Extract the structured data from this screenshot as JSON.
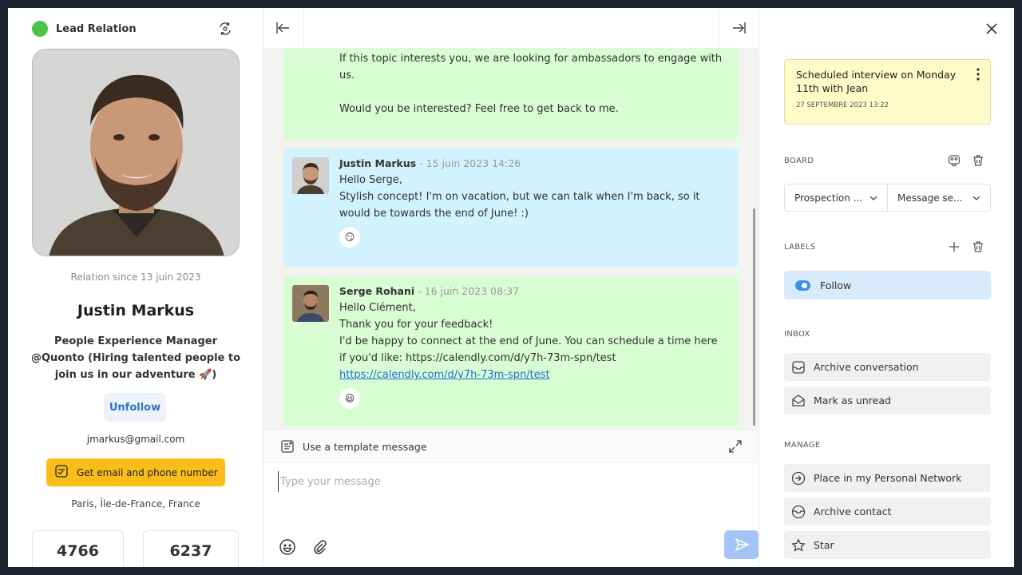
{
  "left": {
    "status_title": "Lead Relation",
    "relation_since": "Relation since 13 juin 2023",
    "name": "Justin Markus",
    "headline": "People Experience Manager @Quonto (Hiring talented people to join us in our adventure 🚀)",
    "unfollow_label": "Unfollow",
    "email": "jmarkus@gmail.com",
    "get_contact_label": "Get email and phone number",
    "location": "Paris, Île-de-France, France",
    "stats": [
      "4766",
      "6237"
    ]
  },
  "conversation": {
    "msg0": {
      "line1": "If this topic interests you, we are looking for ambassadors to engage with us.",
      "line2": "Would you be interested? Feel free to get back to me."
    },
    "msg1": {
      "author": "Justin Markus",
      "date": " - 15 juin 2023 14:26",
      "line1": "Hello Serge,",
      "line2": "Stylish concept! I'm on vacation, but we can talk when I'm back, so it would be towards the end of June! :)",
      "reaction": "😏"
    },
    "msg2": {
      "author": "Serge Rohani",
      "date": " - 16 juin 2023 08:37",
      "line1": "Hello Clément,",
      "line2": "Thank you for your feedback!",
      "line3": "I'd be happy to connect at the end of June. You can schedule a time here if you'd like: https://calendly.com/d/y7h-73m-spn/test ",
      "link": "https://calendly.com/d/y7h-73m-spn/test",
      "reaction": "😃"
    },
    "template_label": "Use a template message",
    "input_placeholder": "Type your message"
  },
  "right": {
    "note": {
      "text": "Scheduled interview on Monday 11th with Jean",
      "date": "27 SEPTEMBRE 2023 13:22"
    },
    "board_title": "BOARD",
    "board_dropdowns": [
      "Prospection ...",
      "Message se..."
    ],
    "labels_title": "LABELS",
    "label_follow": "Follow",
    "inbox_title": "INBOX",
    "inbox_actions": [
      "Archive conversation",
      "Mark as unread"
    ],
    "manage_title": "MANAGE",
    "manage_actions": [
      "Place in my Personal Network",
      "Archive contact",
      "Star"
    ]
  },
  "colors": {
    "status_green": "#4cc44a",
    "accent_yellow": "#fbbd1a",
    "bubble_green": "#d9fdd3",
    "bubble_blue": "#d2f3fd",
    "note_yellow": "#fdfcc8",
    "label_blue": "#d8ebfc"
  }
}
